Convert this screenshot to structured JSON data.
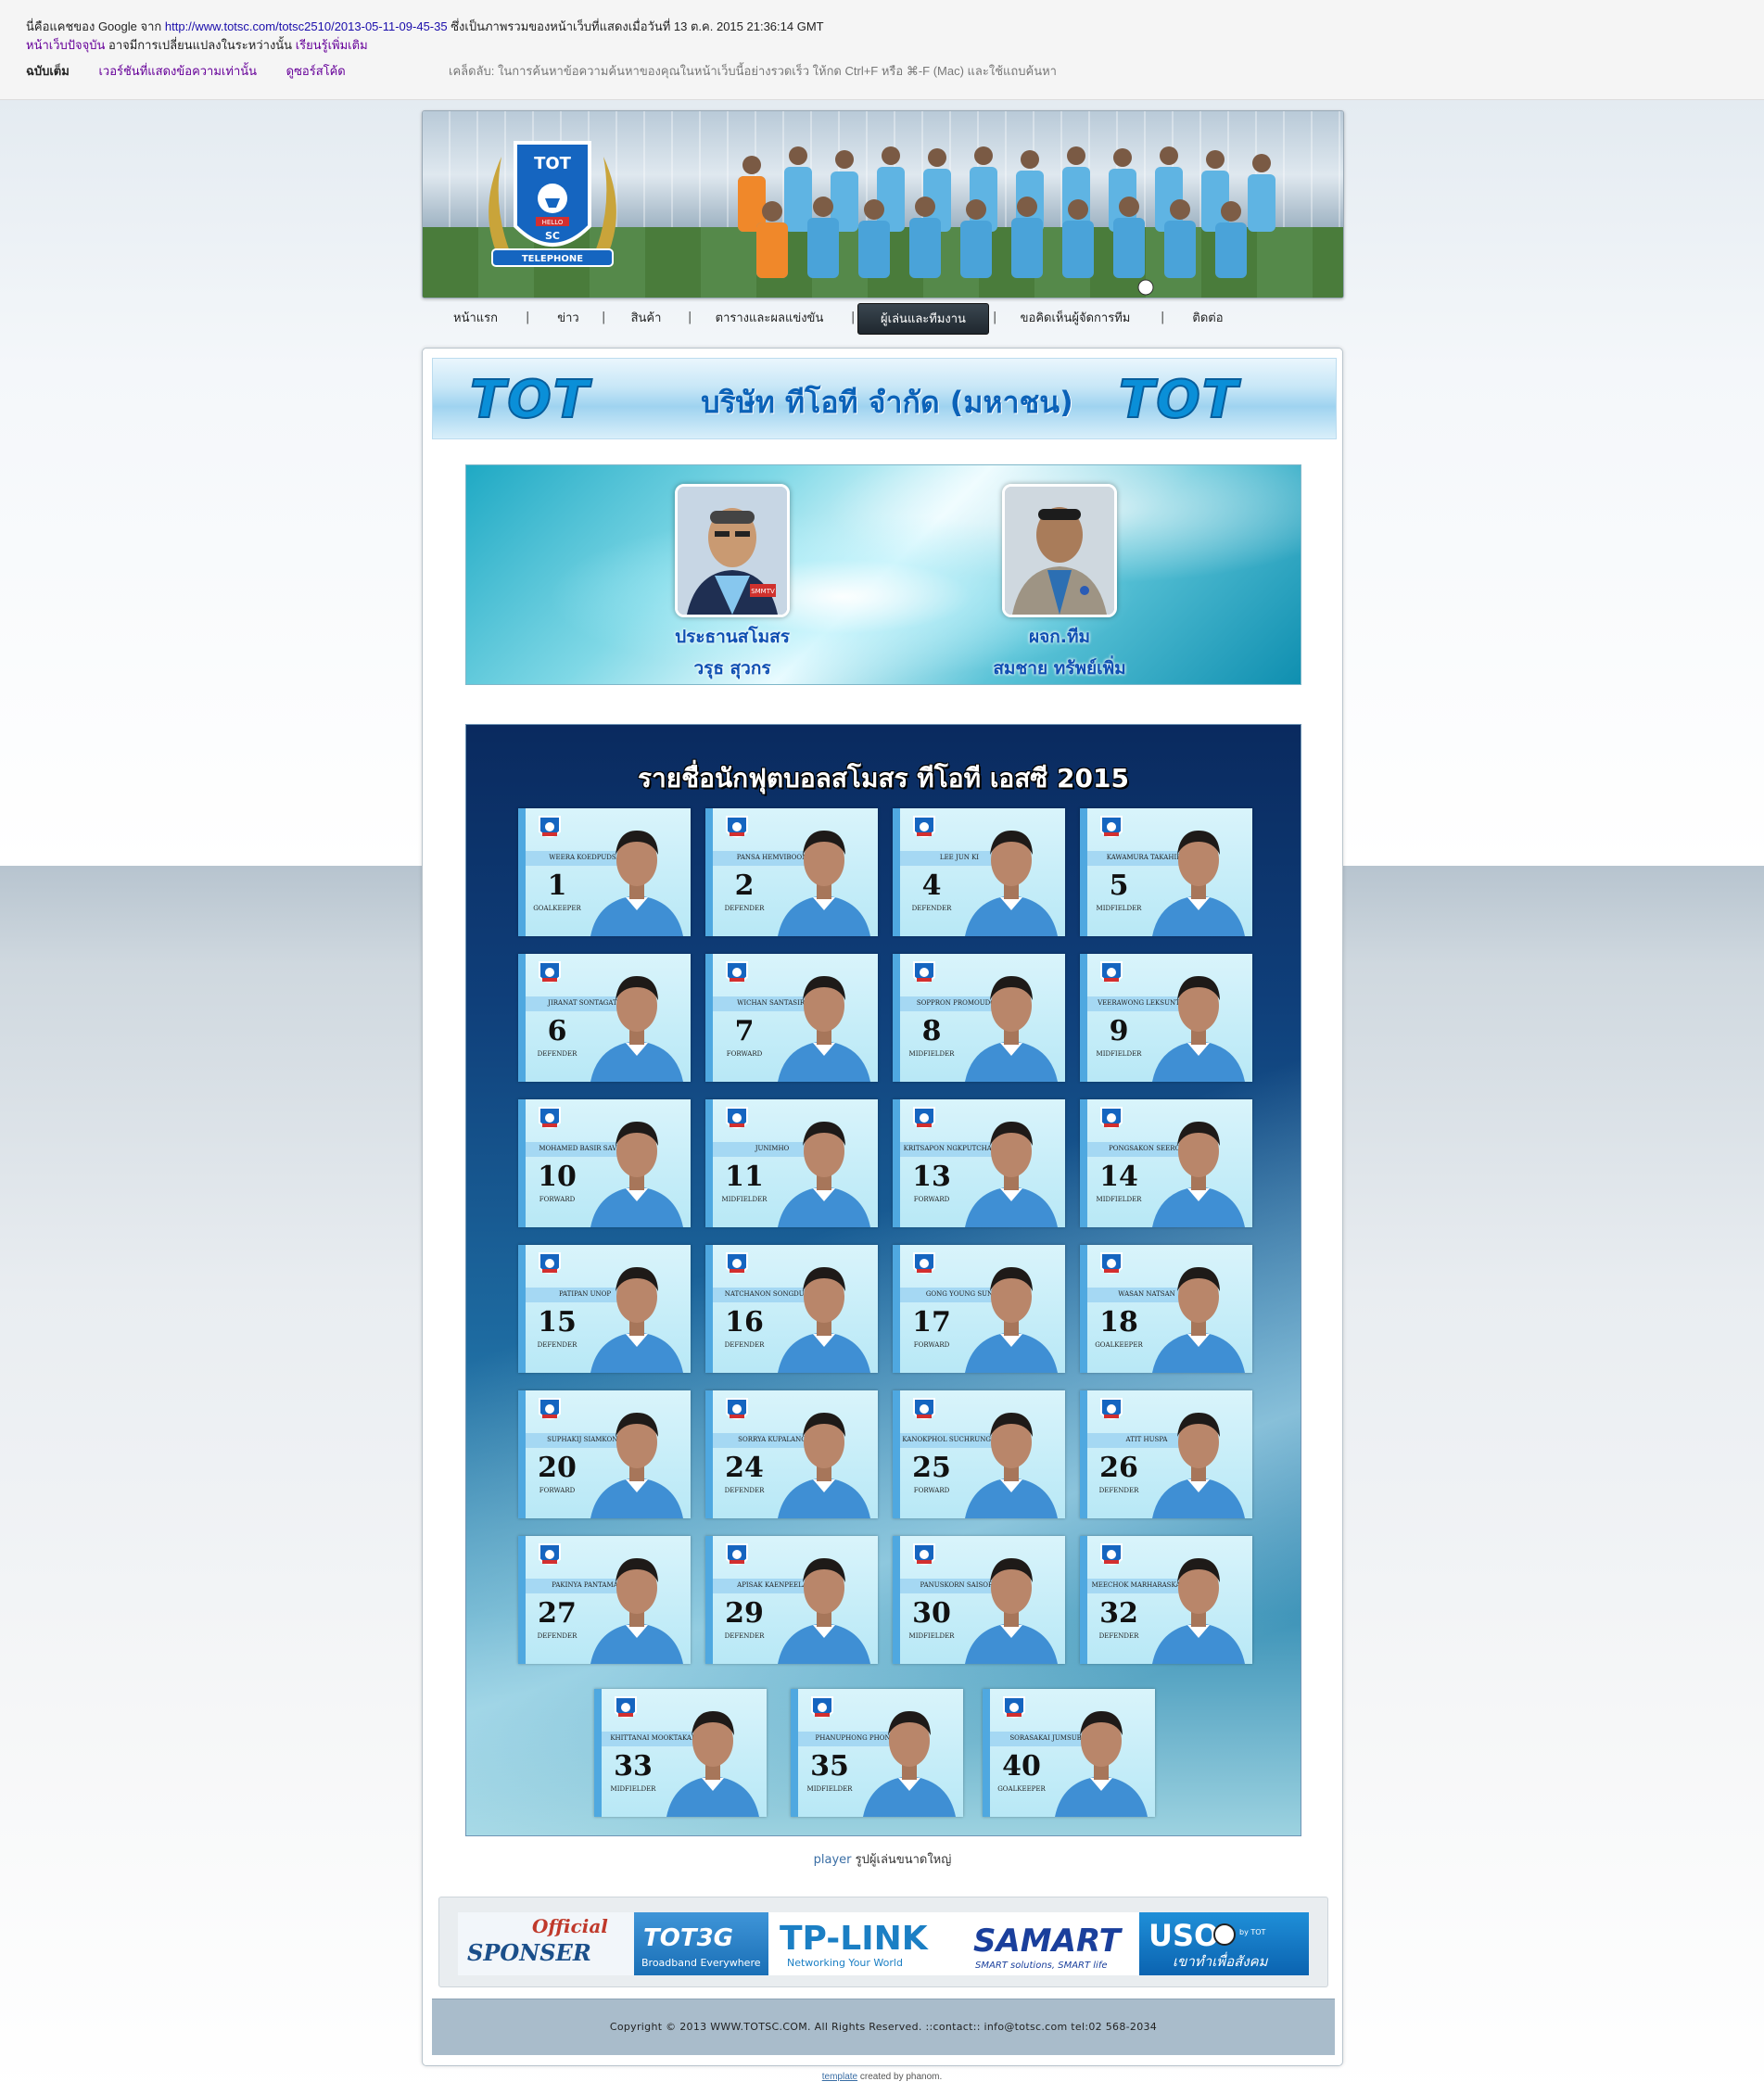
{
  "cache": {
    "intro": "นี่คือแคชของ Google จาก",
    "url": "http://www.totsc.com/totsc2510/2013-05-11-09-45-35",
    "snapshot_text": "ซึ่งเป็นภาพรวมของหน้าเว็บที่แสดงเมื่อวันที่ 13 ต.ค. 2015 21:36:14 GMT",
    "current_page_link": "หน้าเว็บปัจจุบัน",
    "change_text": "อาจมีการเปลี่ยนแปลงในระหว่างนั้น",
    "learn_more_link": "เรียนรู้เพิ่มเติม",
    "tab_full": "ฉบับเต็ม",
    "tab_text_only": "เวอร์ชันที่แสดงข้อความเท่านั้น",
    "tab_view_source": "ดูซอร์สโค้ด",
    "tip": "เคล็ดลับ: ในการค้นหาข้อความค้นหาของคุณในหน้าเว็บนี้อย่างรวดเร็ว ให้กด Ctrl+F หรือ ⌘-F (Mac) และใช้แถบค้นหา"
  },
  "nav": {
    "items": [
      {
        "label": "หน้าแรก"
      },
      {
        "label": "ข่าว"
      },
      {
        "label": "สินค้า"
      },
      {
        "label": "ตารางและผลแข่งขัน"
      },
      {
        "label": "ผู้เล่นและทีมงาน"
      },
      {
        "label": "ขอคิดเห็นผู้จัดการทีม"
      },
      {
        "label": "ติดต่อ"
      }
    ],
    "active_index": 4,
    "separator": "|"
  },
  "tot_banner": {
    "logo_text": "TOT",
    "company": "บริษัท ทีโอที จำกัด (มหาชน)"
  },
  "staff": [
    {
      "role": "ประธานสโมสร",
      "name": "วรุธ สุวกร",
      "overlay": "SMMTV"
    },
    {
      "role": "ผจก.ทีม",
      "name": "สมชาย ทรัพย์เพิ่ม"
    }
  ],
  "roster": {
    "title": "รายชื่อนักฟุตบอลสโมสร ทีโอที เอสซี 2015",
    "players": [
      {
        "name": "Weera Koedpudsa",
        "number": "1",
        "position": "Goalkeeper"
      },
      {
        "name": "Pansa Hemviboon",
        "number": "2",
        "position": "Defender"
      },
      {
        "name": "Lee Jun Ki",
        "number": "4",
        "position": "Defender"
      },
      {
        "name": "Kawamura Takahiro",
        "number": "5",
        "position": "Midfielder"
      },
      {
        "name": "Jiranat Sontagate",
        "number": "6",
        "position": "Defender"
      },
      {
        "name": "Wichan Santasiri",
        "number": "7",
        "position": "Forward"
      },
      {
        "name": "Soppron Promoudom",
        "number": "8",
        "position": "Midfielder"
      },
      {
        "name": "Veerawong Leksuntorn",
        "number": "9",
        "position": "Midfielder"
      },
      {
        "name": "Mohamed Basir Savage",
        "number": "10",
        "position": "Forward"
      },
      {
        "name": "Junimho",
        "number": "11",
        "position": "Midfielder"
      },
      {
        "name": "Kritsapon Ngkputchakakul",
        "number": "13",
        "position": "Forward"
      },
      {
        "name": "Pongsakon Seerot",
        "number": "14",
        "position": "Midfielder"
      },
      {
        "name": "Patipan Unop",
        "number": "15",
        "position": "Defender"
      },
      {
        "name": "Natchanon Songduang",
        "number": "16",
        "position": "Defender"
      },
      {
        "name": "Gong Young Sun",
        "number": "17",
        "position": "Forward"
      },
      {
        "name": "Wasan Natsan",
        "number": "18",
        "position": "Goalkeeper"
      },
      {
        "name": "Suphakij Siamkong",
        "number": "20",
        "position": "Forward"
      },
      {
        "name": "Sorrya Kupalang",
        "number": "24",
        "position": "Defender"
      },
      {
        "name": "Kanokphol Suchrungruang",
        "number": "25",
        "position": "Forward"
      },
      {
        "name": "Atit Huspa",
        "number": "26",
        "position": "Defender"
      },
      {
        "name": "Pakinya Pantama",
        "number": "27",
        "position": "Defender"
      },
      {
        "name": "Apisak Kaenpeela",
        "number": "29",
        "position": "Defender"
      },
      {
        "name": "Panuskorn Saisorn",
        "number": "30",
        "position": "Midfielder"
      },
      {
        "name": "Meechok Marharaskaukun",
        "number": "32",
        "position": "Defender"
      },
      {
        "name": "Khittanai Mooktakanosa",
        "number": "33",
        "position": "Midfielder"
      },
      {
        "name": "Phanuphong Phonsa",
        "number": "35",
        "position": "Midfielder"
      },
      {
        "name": "Sorasakai Jumsubai",
        "number": "40",
        "position": "Goalkeeper"
      }
    ]
  },
  "caption": {
    "link": "player",
    "text": "รูปผู้เล่นขนาดใหญ่"
  },
  "sponsors": {
    "official_line1": "Official",
    "official_line2": "SPONSER",
    "tot3g": "TOT3G",
    "tot3g_tag": "Broadband Everywhere",
    "tplink": "TP-LINK",
    "tplink_tag": "Networking Your World",
    "samart": "SAMART",
    "samart_tag": "SMART solutions, SMART life",
    "uso": "USO",
    "uso_by": "by TOT",
    "uso_tag": "เขาทำเพื่อสังคม"
  },
  "footer": {
    "copyright": "Copyright © 2013 WWW.TOTSC.COM. All Rights Reserved. ::contact:: info@totsc.com tel:02 568-2034"
  },
  "credit": {
    "link": "template",
    "text": "created by phanom."
  },
  "colors": {
    "nav_active": "#2b353d",
    "link_purple": "#660099",
    "tot_blue": "#0a8fd8"
  }
}
